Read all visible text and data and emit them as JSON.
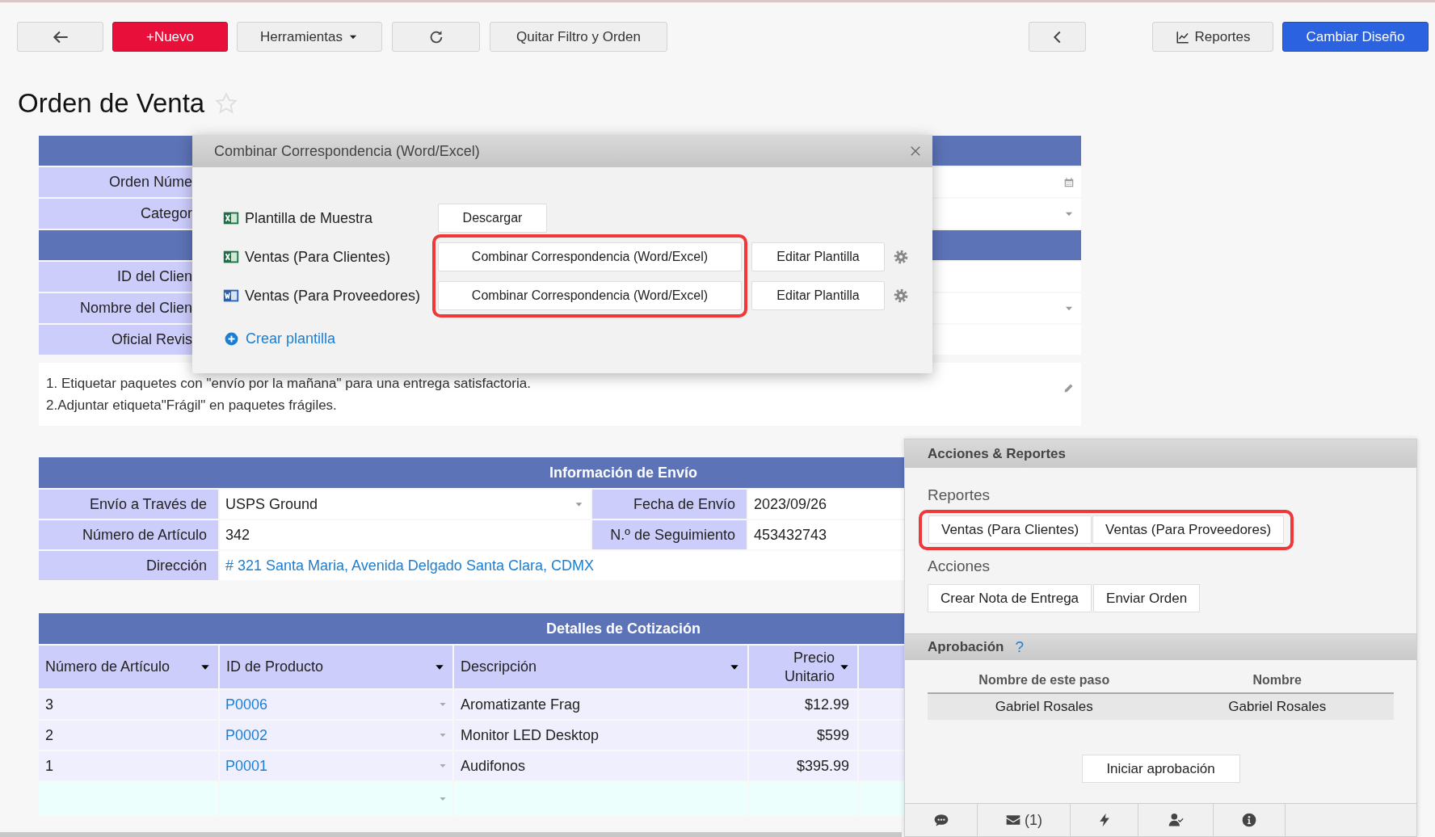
{
  "toolbar": [
    {
      "kind": "back"
    },
    {
      "kind": "new",
      "label": "+Nuevo"
    },
    {
      "kind": "menu",
      "label": "Herramientas"
    },
    {
      "kind": "refresh"
    },
    {
      "kind": "plain",
      "label": "Quitar Filtro y Orden"
    },
    {
      "kind": "prev"
    },
    {
      "kind": "reports",
      "label": "Reportes"
    },
    {
      "kind": "primary",
      "label": "Cambiar Diseño"
    }
  ],
  "page_title": "Orden de Venta",
  "starred": false,
  "header_section": {
    "groups": [
      {
        "rows": [
          {
            "label": "Orden Núme",
            "kind": "date"
          },
          {
            "label": "Categor",
            "kind": "select"
          }
        ]
      },
      {
        "rows": [
          {
            "label": "ID del Clien",
            "kind": "text"
          },
          {
            "label": "Nombre del Clien",
            "kind": "select"
          },
          {
            "label": "Oficial Revis",
            "kind": "text"
          }
        ]
      }
    ],
    "notes": [
      "1. Etiquetar paquetes con \"envío por la mañana\" para una entrega satisfactoria.",
      "2.Adjuntar etiqueta\"Frágil\" en paquetes frágiles."
    ]
  },
  "shipping": {
    "title": "Información de Envío",
    "rows": [
      {
        "cells": [
          {
            "label": "Envío a Través de",
            "value": "USPS Ground",
            "kind": "select"
          },
          {
            "label": "Fecha de Envío",
            "value": "2023/09/26",
            "kind": "text"
          }
        ]
      },
      {
        "cells": [
          {
            "label": "Número de Artículo",
            "value": "342",
            "kind": "text"
          },
          {
            "label": "N.º de Seguimiento",
            "value": "453432743",
            "kind": "text"
          }
        ]
      },
      {
        "cells": [
          {
            "label": "Dirección",
            "value": "# 321 Santa Maria, Avenida Delgado Santa Clara, CDMX",
            "kind": "link"
          }
        ]
      }
    ]
  },
  "quote": {
    "title": "Detalles de Cotización",
    "columns": [
      "Número de Artículo",
      "ID de Producto",
      "Descripción",
      "Precio Unitario"
    ],
    "rows": [
      {
        "item": "3",
        "product": "P0006",
        "description": "Aromatizante Frag",
        "price": "$12.99"
      },
      {
        "item": "2",
        "product": "P0002",
        "description": "Monitor LED Desktop",
        "price": "$599"
      },
      {
        "item": "1",
        "product": "P0001",
        "description": "Audifonos",
        "price": "$395.99"
      }
    ]
  },
  "mail_merge_dialog": {
    "title": "Combinar Correspondencia (Word/Excel)",
    "highlighted": true,
    "templates": [
      {
        "kind": "excel",
        "name": "Plantilla de Muestra",
        "action": "Descargar"
      },
      {
        "kind": "excel",
        "name": "Ventas (Para Clientes)",
        "action": "Combinar Correspondencia (Word/Excel)",
        "edit": "Editar Plantilla"
      },
      {
        "kind": "word",
        "name": "Ventas (Para Proveedores)",
        "action": "Combinar Correspondencia (Word/Excel)",
        "edit": "Editar Plantilla"
      }
    ],
    "create_link": "Crear plantilla"
  },
  "side_panel": {
    "title": "Acciones & Reportes",
    "reports_label": "Reportes",
    "reports_highlighted": true,
    "reports": [
      "Ventas (Para Clientes)",
      "Ventas (Para Proveedores)"
    ],
    "actions_label": "Acciones",
    "actions": [
      "Crear Nota de Entrega",
      "Enviar Orden"
    ]
  },
  "approval": {
    "title": "Aprobación",
    "help": "?",
    "columns": [
      "Nombre de este paso",
      "Nombre"
    ],
    "rows": [
      [
        "Gabriel Rosales",
        "Gabriel Rosales"
      ]
    ],
    "button": "Iniciar aprobación"
  },
  "footer_tabs": [
    {
      "kind": "comment"
    },
    {
      "kind": "mail",
      "label": "(1)"
    },
    {
      "kind": "bolt"
    },
    {
      "kind": "user-check"
    },
    {
      "kind": "info"
    }
  ]
}
